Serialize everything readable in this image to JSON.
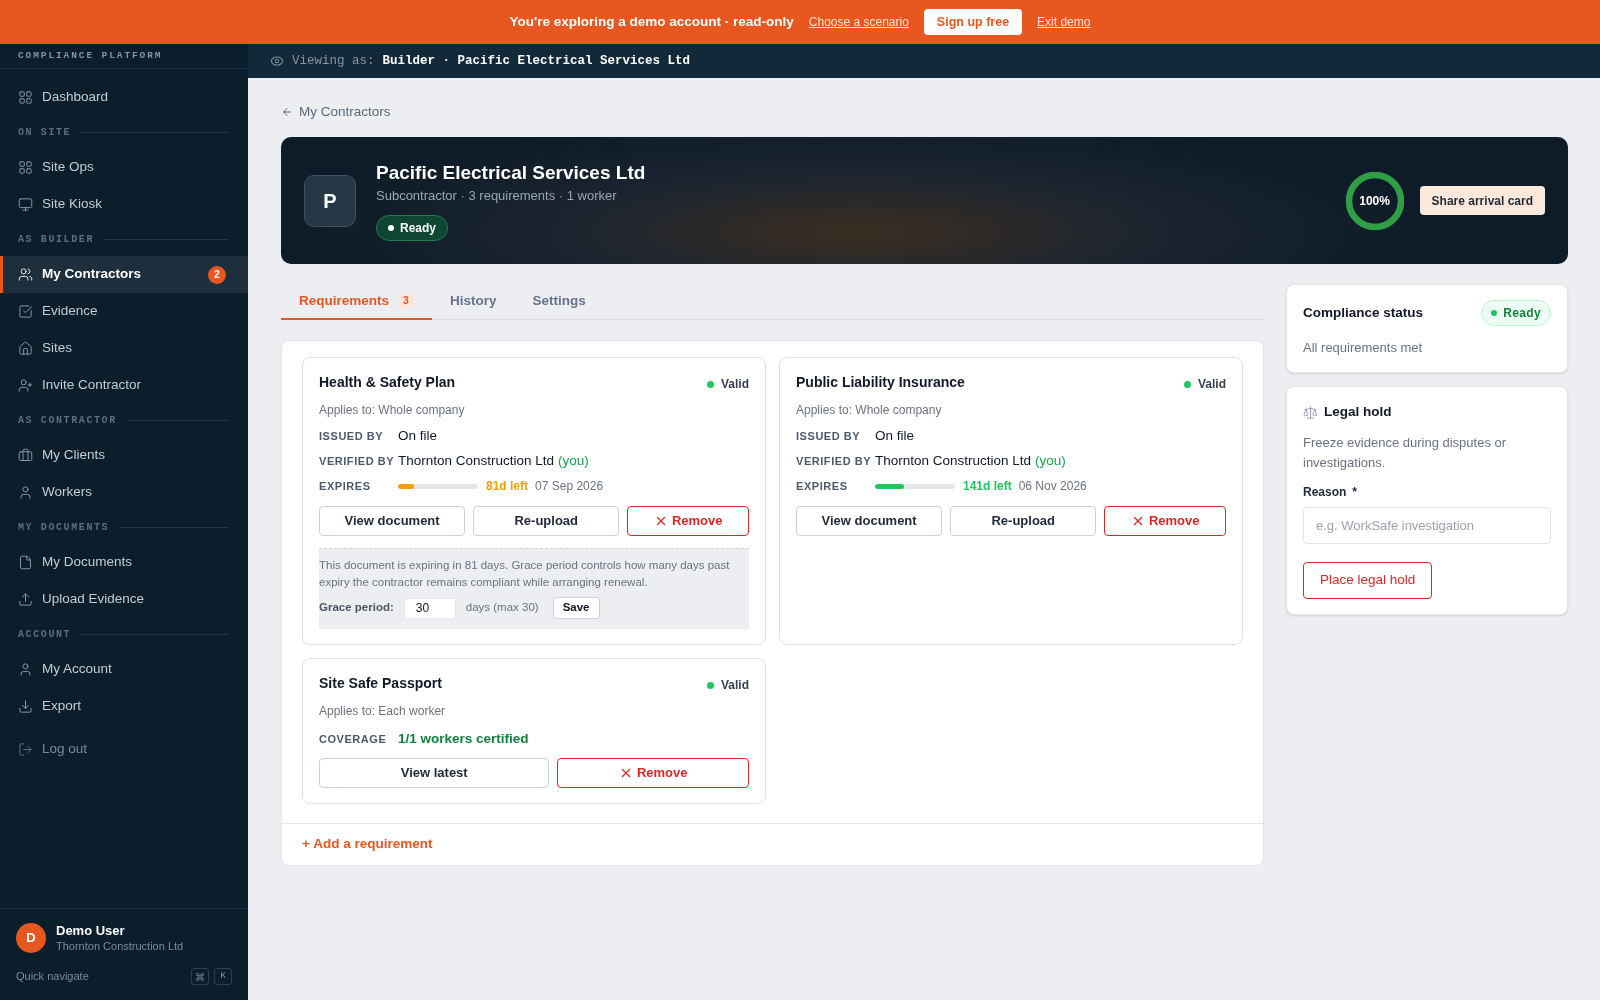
{
  "banner": {
    "message": "You're exploring a demo account · read-only",
    "scenario_link": "Choose a scenario",
    "signup_button": "Sign up free",
    "exit_link": "Exit demo"
  },
  "sidebar": {
    "brand": "COMPLIANCE PLATFORM",
    "sections": [
      {
        "items": [
          {
            "label": "Dashboard",
            "selected": false
          }
        ]
      },
      {
        "heading": "ON SITE",
        "items": [
          {
            "label": "Site Ops",
            "selected": false
          },
          {
            "label": "Site Kiosk",
            "selected": false
          }
        ]
      },
      {
        "heading": "AS BUILDER",
        "items": [
          {
            "label": "My Contractors",
            "selected": true,
            "badge": "2"
          },
          {
            "label": "Evidence",
            "selected": false
          },
          {
            "label": "Sites",
            "selected": false
          },
          {
            "label": "Invite Contractor",
            "selected": false
          }
        ]
      },
      {
        "heading": "AS CONTRACTOR",
        "items": [
          {
            "label": "My Clients",
            "selected": false
          },
          {
            "label": "Workers",
            "selected": false
          }
        ]
      },
      {
        "heading": "MY DOCUMENTS",
        "items": [
          {
            "label": "My Documents",
            "selected": false
          },
          {
            "label": "Upload Evidence",
            "selected": false
          }
        ]
      },
      {
        "heading": "ACCOUNT",
        "items": [
          {
            "label": "My Account",
            "selected": false
          },
          {
            "label": "Export",
            "selected": false
          }
        ]
      }
    ],
    "logout": "Log out",
    "user": {
      "initial": "D",
      "name": "Demo User",
      "organization": "Thornton Construction Ltd"
    },
    "quick_nav": {
      "label": "Quick navigate",
      "key": "K"
    }
  },
  "viewing_bar": {
    "label": "Viewing as:",
    "value": "Builder · Pacific Electrical Services Ltd"
  },
  "back_link": "My Contractors",
  "header": {
    "initial": "P",
    "name": "Pacific Electrical Services Ltd",
    "subtitle": "Subcontractor · 3 requirements · 1 worker",
    "status": "Ready",
    "score": {
      "label": "100%",
      "level": 1
    },
    "share_button": "Share arrival card"
  },
  "tabs": [
    {
      "label": "Requirements",
      "badge": "3",
      "selected": true
    },
    {
      "label": "History",
      "selected": false
    },
    {
      "label": "Settings",
      "selected": false
    }
  ],
  "requirements": [
    {
      "kind": "document",
      "title": "Health & Safety Plan",
      "status": "Valid",
      "applies_to": "Applies to: Whole company",
      "issued_by": {
        "label": "ISSUED BY",
        "value": "On file"
      },
      "verified_by": {
        "label": "VERIFIED BY",
        "value": "Thornton Construction Ltd",
        "note": "(you)"
      },
      "expires": {
        "label": "EXPIRES",
        "level": 0.2,
        "color": "#f59e0b",
        "remaining": "81d left",
        "date": "07 Sep 2026"
      },
      "buttons": [
        {
          "label": "View document",
          "kind": "default"
        },
        {
          "label": "Re-upload",
          "kind": "default"
        },
        {
          "label": "Remove",
          "kind": "danger"
        }
      ],
      "grace": {
        "message": "This document is expiring in 81 days. Grace period controls how many days past expiry the contractor remains compliant while arranging renewal.",
        "label": "Grace period:",
        "value": "30",
        "hint": "days (max 30)",
        "save_button": "Save"
      }
    },
    {
      "kind": "document",
      "title": "Public Liability Insurance",
      "status": "Valid",
      "applies_to": "Applies to: Whole company",
      "issued_by": {
        "label": "ISSUED BY",
        "value": "On file"
      },
      "verified_by": {
        "label": "VERIFIED BY",
        "value": "Thornton Construction Ltd",
        "note": "(you)"
      },
      "expires": {
        "label": "EXPIRES",
        "level": 0.36,
        "color": "#22c55e",
        "remaining": "141d left",
        "date": "06 Nov 2026"
      },
      "buttons": [
        {
          "label": "View document",
          "kind": "default"
        },
        {
          "label": "Re-upload",
          "kind": "default"
        },
        {
          "label": "Remove",
          "kind": "danger"
        }
      ]
    },
    {
      "kind": "coverage",
      "title": "Site Safe Passport",
      "status": "Valid",
      "applies_to": "Applies to: Each worker",
      "coverage": {
        "label": "COVERAGE",
        "value": "1/1 workers certified"
      },
      "buttons": [
        {
          "label": "View latest",
          "kind": "default"
        },
        {
          "label": "Remove",
          "kind": "danger"
        }
      ]
    }
  ],
  "add_requirement": "+ Add a requirement",
  "compliance_status": {
    "title": "Compliance status",
    "status": "Ready",
    "summary": "All requirements met"
  },
  "legal_hold": {
    "title": "Legal hold",
    "description": "Freeze evidence during disputes or investigations.",
    "field_label": "Reason",
    "required_mark": "*",
    "placeholder": "e.g. WorkSafe investigation",
    "button": "Place legal hold"
  }
}
